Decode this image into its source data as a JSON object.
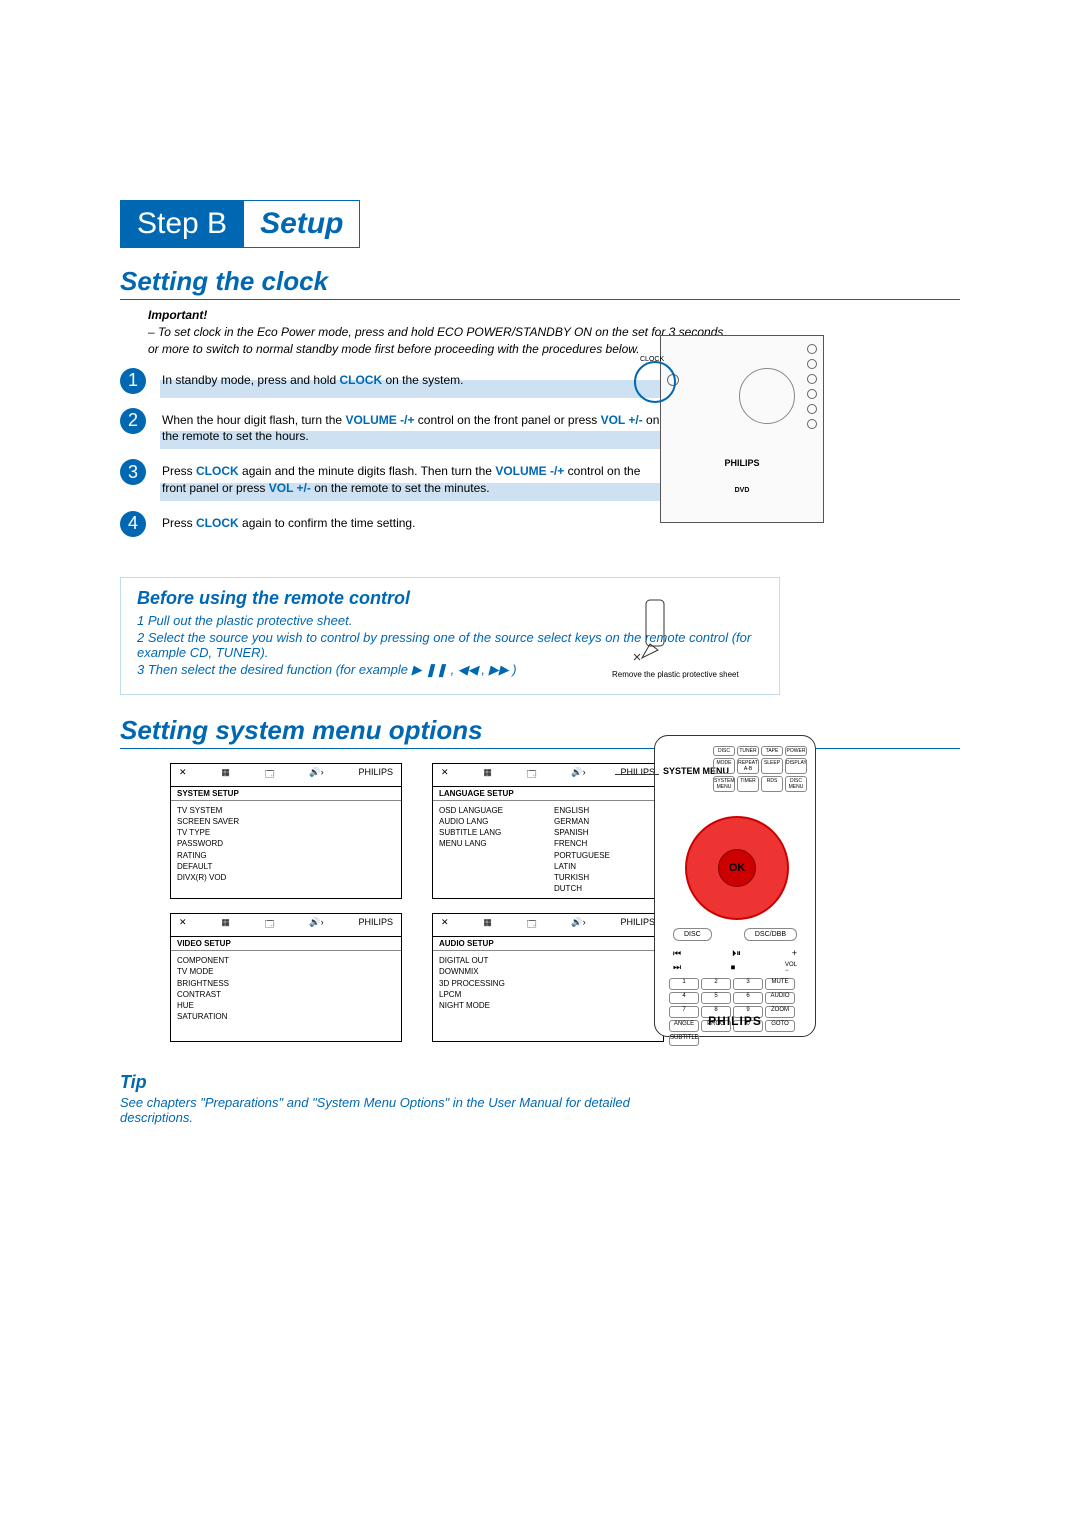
{
  "step_badge": {
    "left": "Step B",
    "right": "Setup"
  },
  "section1": {
    "title": "Setting the clock",
    "important_label": "Important!",
    "important_lines": [
      "– To set clock in the Eco Power mode, press and hold ECO POWER/STANDBY ON on the set for 3 seconds",
      "or more to switch to normal standby mode first before proceeding with the procedures below."
    ],
    "steps": [
      {
        "n": "1",
        "pre": "In standby mode, press and hold ",
        "kw": "CLOCK",
        "post": " on the system."
      },
      {
        "n": "2",
        "pre": "When the hour digit flash, turn the ",
        "kw": "VOLUME -/+",
        "mid": " control on the front panel or press ",
        "kw2": "VOL +/-",
        "post": " on the remote to set the hours."
      },
      {
        "n": "3",
        "pre": "Press ",
        "kw": "CLOCK",
        "mid": " again and the minute digits flash. Then turn the ",
        "kw2": "VOLUME -/+",
        "mid2": " control on the front panel or press ",
        "kw3": "VOL +/-",
        "post": " on the remote to set the minutes."
      },
      {
        "n": "4",
        "pre": "Press ",
        "kw": "CLOCK",
        "post": " again to confirm the time setting."
      }
    ]
  },
  "remote_before": {
    "title": "Before using the remote control",
    "lines": [
      "1 Pull out the plastic protective sheet.",
      "2 Select the source you wish to control by pressing one of the source select keys on the remote control (for example CD, TUNER).",
      "3 Then select the desired function (for example  ▶ ❚❚ ,  ◀◀ , ▶▶ )"
    ],
    "illus_caption": "Remove the plastic protective sheet"
  },
  "section2": {
    "title": "Setting system menu options",
    "menus": [
      {
        "header_icons": [
          "✕",
          "▦",
          "🗔",
          "🔊›",
          "PHILIPS"
        ],
        "title": "SYSTEM SETUP",
        "left": [
          "TV SYSTEM",
          "SCREEN SAVER",
          "TV TYPE",
          "PASSWORD",
          "RATING",
          "DEFAULT",
          "DIVX(R) VOD"
        ],
        "right": []
      },
      {
        "header_icons": [
          "✕",
          "▦",
          "🗔",
          "🔊›",
          "PHILIPS"
        ],
        "title": "LANGUAGE SETUP",
        "left": [
          "OSD LANGUAGE",
          "AUDIO LANG",
          "SUBTITLE LANG",
          "MENU LANG"
        ],
        "right": [
          "ENGLISH",
          "GERMAN",
          "SPANISH",
          "FRENCH",
          "PORTUGUESE",
          "LATIN",
          "TURKISH",
          "DUTCH"
        ]
      },
      {
        "header_icons": [
          "✕",
          "▦",
          "🗔",
          "🔊›",
          "PHILIPS"
        ],
        "title": "VIDEO SETUP",
        "left": [
          "COMPONENT",
          "TV MODE",
          "BRIGHTNESS",
          "CONTRAST",
          "HUE",
          "SATURATION"
        ],
        "right": []
      },
      {
        "header_icons": [
          "✕",
          "▦",
          "🗔",
          "🔊›",
          "PHILIPS"
        ],
        "title": "AUDIO SETUP",
        "left": [
          "DIGITAL OUT",
          "DOWNMIX",
          "3D PROCESSING",
          "LPCM",
          "NIGHT MODE"
        ],
        "right": []
      }
    ]
  },
  "tip": {
    "title": "Tip",
    "body": "See chapters \"Preparations\" and \"System Menu Options\" in the User Manual for detailed descriptions."
  },
  "device": {
    "clock_label": "CLOCK",
    "brand": "PHILIPS",
    "dvd": "DVD"
  },
  "remote_device": {
    "system_menu": "SYSTEM MENU",
    "ok": "OK",
    "brand": "PHILIPS",
    "top_row": [
      "DISC",
      "TUNER",
      "TAPE",
      "POWER",
      "MODE",
      "REPEAT A-B",
      "SLEEP",
      "DISPLAY",
      "SYSTEM MENU",
      "TIMER",
      "RDS",
      "DISC MENU"
    ],
    "mid": [
      "DISC",
      "",
      "DSC/DBB"
    ],
    "numpad": [
      "1",
      "2",
      "3",
      "MUTE",
      "4",
      "5",
      "6",
      "AUDIO",
      "7",
      "8",
      "9",
      "ZOOM",
      "ANGLE",
      "PROG",
      "0",
      "GOTO",
      "SUBTITLE"
    ]
  }
}
